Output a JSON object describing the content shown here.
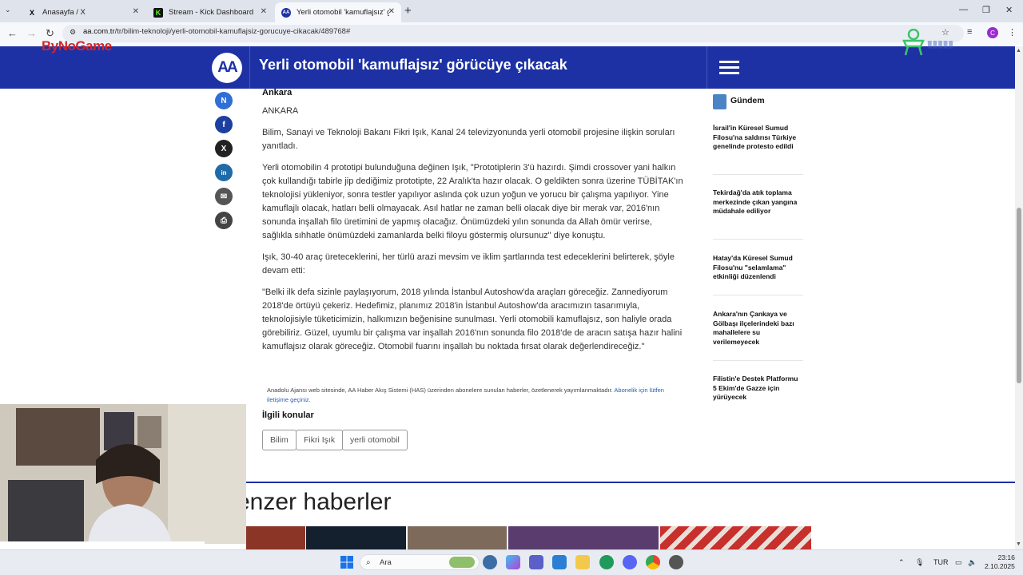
{
  "browser": {
    "tabs": [
      {
        "title": "Anasayfa / X",
        "favicon": "X"
      },
      {
        "title": "Stream - Kick Dashboard",
        "favicon": "K"
      },
      {
        "title": "Yerli otomobil 'kamuflajsız' gör",
        "favicon": "AA"
      }
    ],
    "url_domain": "aa.com.tr",
    "url_path": "/tr/bilim-teknoloji/yerli-otomobil-kamuflajsiz-gorucuye-cikacak/489768#",
    "avatar_letter": "C"
  },
  "overlay": {
    "bynogame": "ByNoGame"
  },
  "header": {
    "logo": "AA",
    "title": "Yerli otomobil 'kamuflajsız' görücüye çıkacak"
  },
  "social": [
    "N",
    "f",
    "X",
    "in",
    "✉",
    "⎙"
  ],
  "article": {
    "location_bold": "Ankara",
    "location": "ANKARA",
    "paragraphs": [
      "Bilim, Sanayi ve Teknoloji Bakanı Fikri Işık, Kanal 24 televizyonunda yerli otomobil projesine ilişkin soruları yanıtladı.",
      "Yerli otomobilin 4 prototipi bulunduğuna değinen Işık, \"Prototiplerin 3'ü hazırdı. Şimdi crossover yani halkın çok kullandığı tabirle jip dediğimiz prototipte, 22 Aralık'ta hazır olacak. O geldikten sonra üzerine TÜBİTAK'ın teknolojisi yükleniyor, sonra testler yapılıyor aslında çok uzun yoğun ve yorucu bir çalışma yapılıyor. Yine kamuflajlı olacak, hatları belli olmayacak. Asıl hatlar ne zaman belli olacak diye bir merak var, 2016'nın sonunda inşallah filo üretimini de yapmış olacağız. Önümüzdeki yılın sonunda da Allah ömür verirse, sağlıkla sıhhatle önümüzdeki zamanlarda belki filoyu göstermiş olursunuz\" diye konuştu.",
      "Işık, 30-40 araç üreteceklerini, her türlü arazi mevsim ve iklim şartlarında test edeceklerini belirterek, şöyle devam etti:",
      "\"Belki ilk defa sizinle paylaşıyorum, 2018 yılında İstanbul Autoshow'da araçları göreceğiz. Zannediyorum 2018'de örtüyü çekeriz. Hedefimiz, planımız 2018'in İstanbul Autoshow'da aracımızın tasarımıyla, teknolojisiyle tüketicimizin, halkımızın beğenisine sunulması. Yerli otomobili kamuflajsız, son haliyle orada görebiliriz. Güzel, uyumlu bir çalışma var inşallah 2016'nın sonunda filo 2018'de de aracın satışa hazır halini kamuflajsız olarak göreceğiz. Otomobil fuarını inşallah bu noktada fırsat olarak değerlendireceğiz.\""
    ],
    "disclaimer": "Anadolu Ajansı web sitesinde, AA Haber Akış Sistemi (HAS) üzerinden abonelere sunulan haberler, özetlenerek yayımlanmaktadır.",
    "disclaimer_link": "Abonelik için lütfen iletişime geçiniz.",
    "related_title": "İlgili konular",
    "tags": [
      "Bilim",
      "Fikri Işık",
      "yerli otomobil"
    ],
    "similar_title": "enzer haberler"
  },
  "sidebar": {
    "title": "Gündem",
    "items": [
      "İsrail'in Küresel Sumud Filosu'na saldırısı Türkiye genelinde protesto edildi",
      "Tekirdağ'da atık toplama merkezinde çıkan yangına müdahale ediliyor",
      "Hatay'da Küresel Sumud Filosu'nu \"selamlama\" etkinliği düzenlendi",
      "Ankara'nın Çankaya ve Gölbaşı ilçelerindeki bazı mahallelere su verilemeyecek",
      "Filistin'e Destek Platformu 5 Ekim'de Gazze için yürüyecek"
    ]
  },
  "taskbar": {
    "search_label": "Ara",
    "language": "TUR",
    "time": "23:16",
    "date": "2.10.2025"
  }
}
